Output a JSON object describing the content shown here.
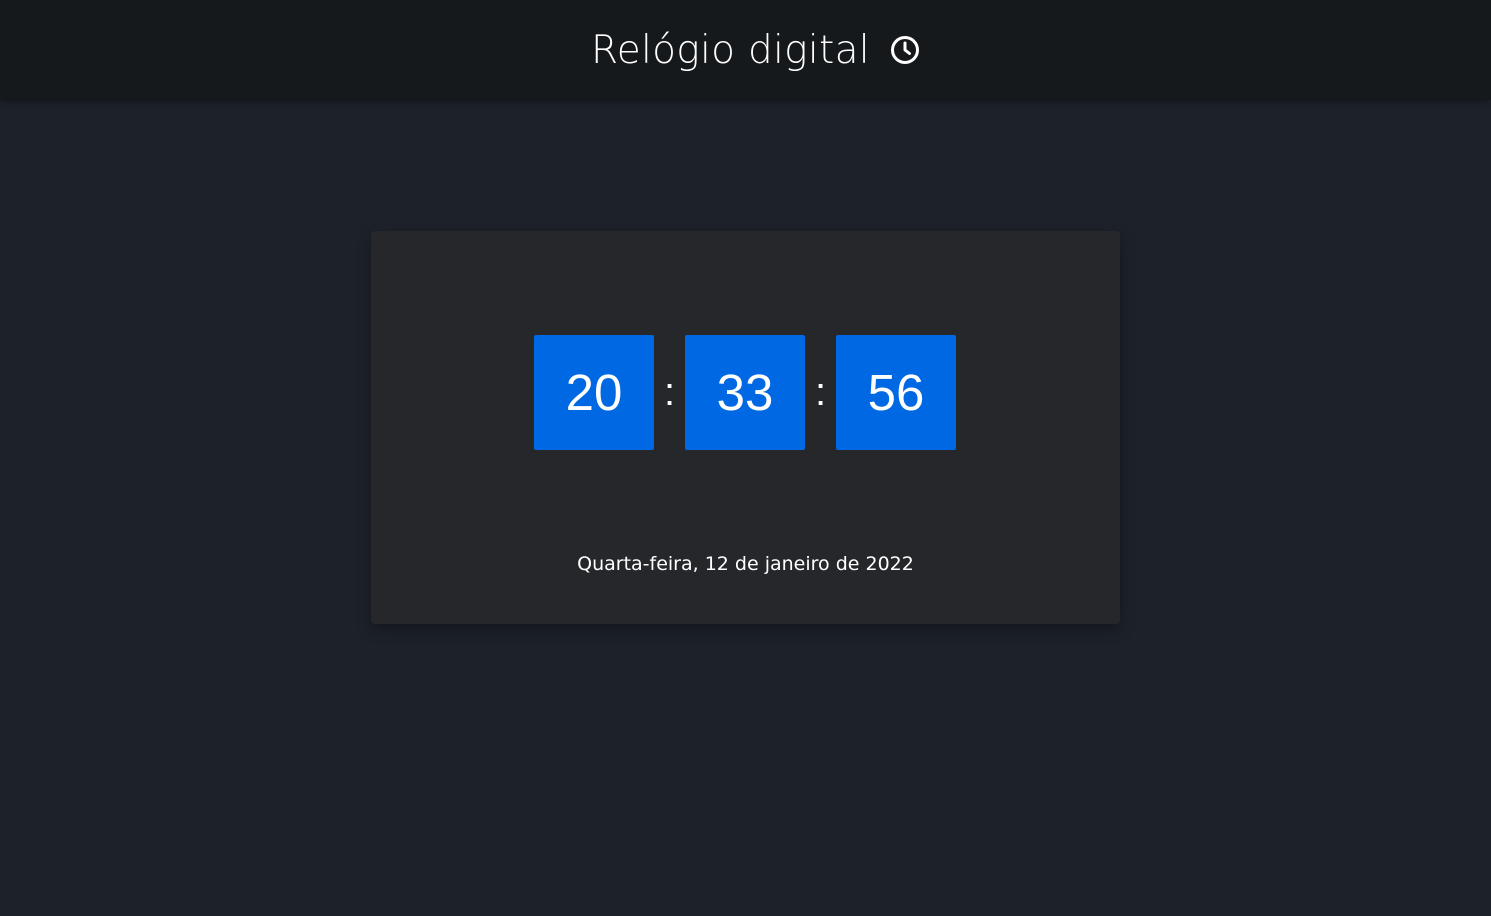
{
  "header": {
    "title": "Relógio digital",
    "icon": "clock-icon"
  },
  "clock": {
    "hours": "20",
    "minutes": "33",
    "seconds": "56",
    "separator": ":",
    "date": "Quarta-feira, 12 de janeiro de 2022"
  },
  "colors": {
    "background": "#1d222a",
    "header_background": "#16191c",
    "card_background": "#26272b",
    "accent": "#0068e2",
    "text": "#ffffff"
  }
}
